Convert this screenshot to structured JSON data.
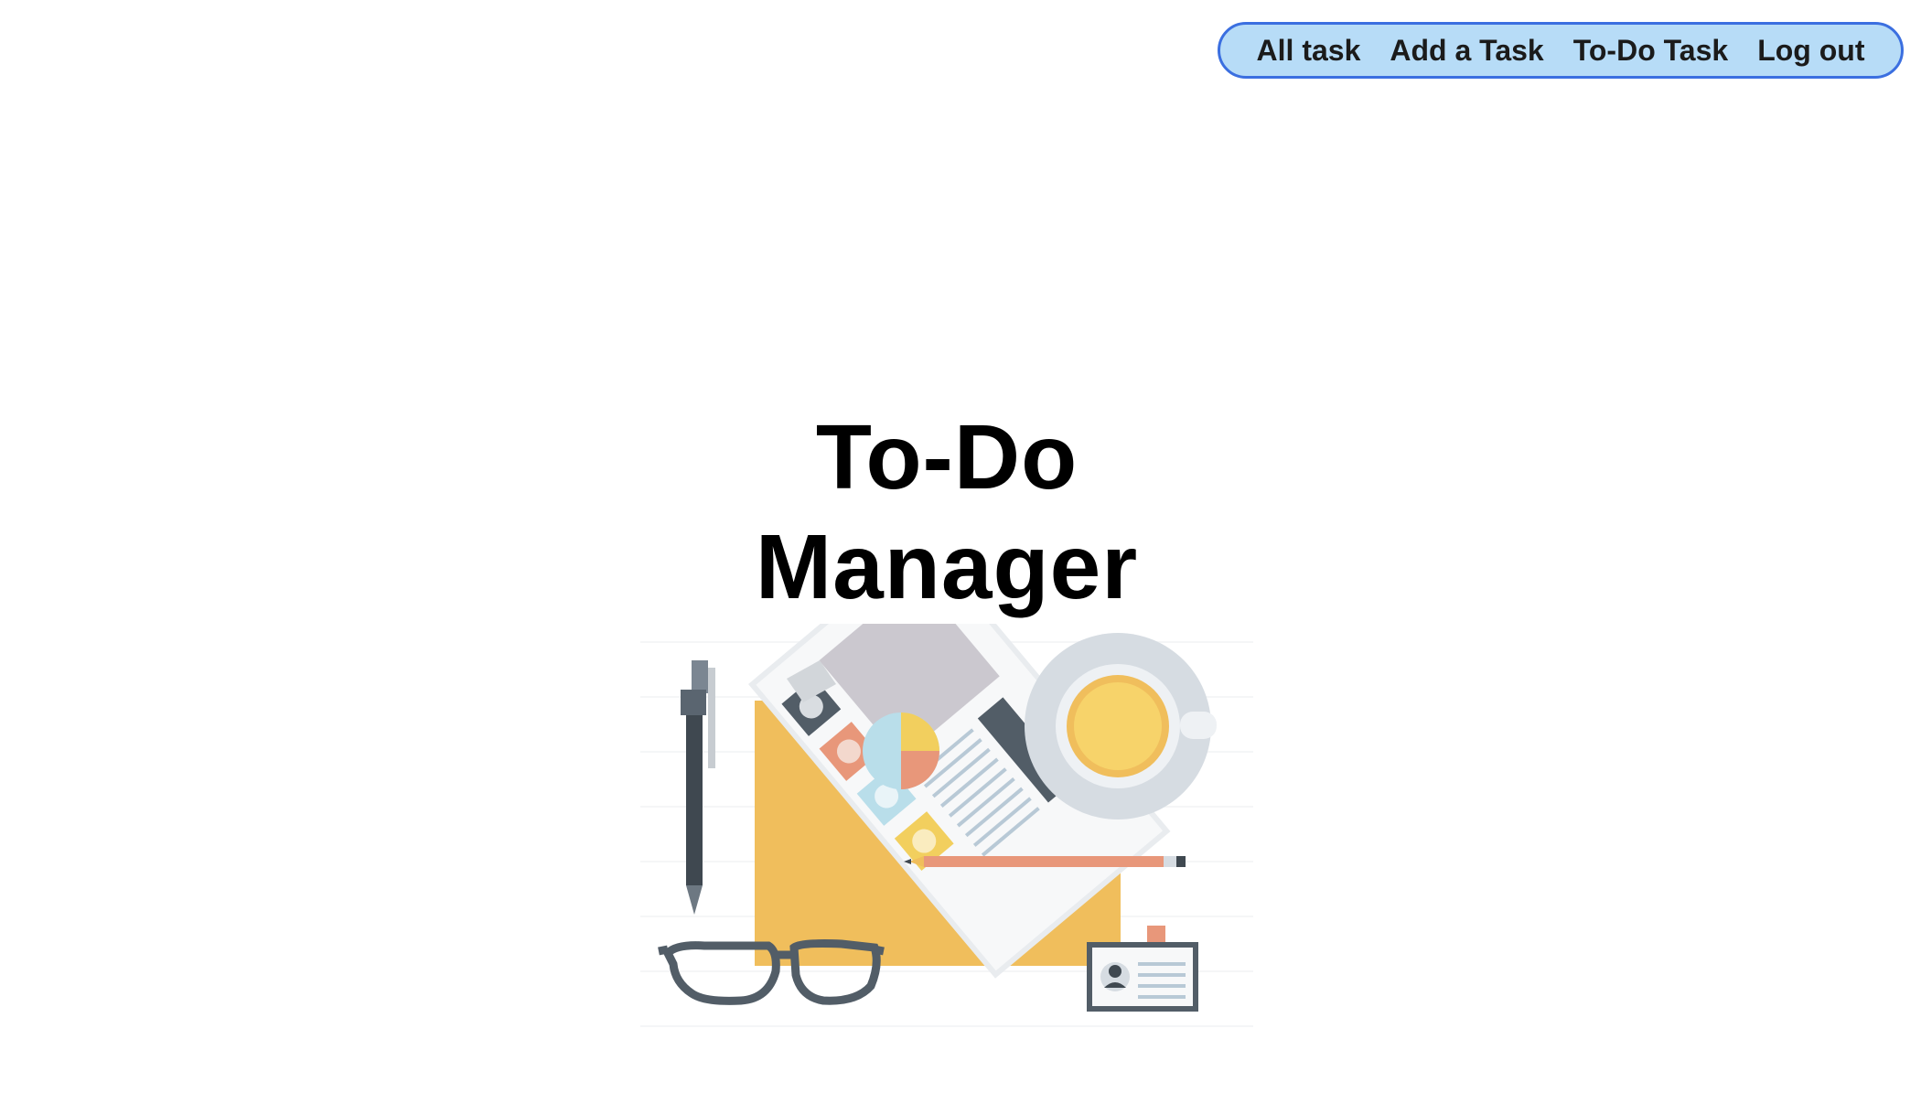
{
  "nav": {
    "items": [
      {
        "label": "All task"
      },
      {
        "label": "Add a Task"
      },
      {
        "label": "To-Do Task"
      },
      {
        "label": "Log out"
      }
    ]
  },
  "hero": {
    "title_line1": "To-Do",
    "title_line2": "Manager"
  },
  "illustration": {
    "icon": "desk-workspace-illustration",
    "palette": {
      "yellow": "#f0be5c",
      "slate": "#525d67",
      "salmon": "#e8977a",
      "sky": "#b9deea",
      "light_gray": "#d8dde2",
      "paper": "#f5f6f7"
    }
  }
}
